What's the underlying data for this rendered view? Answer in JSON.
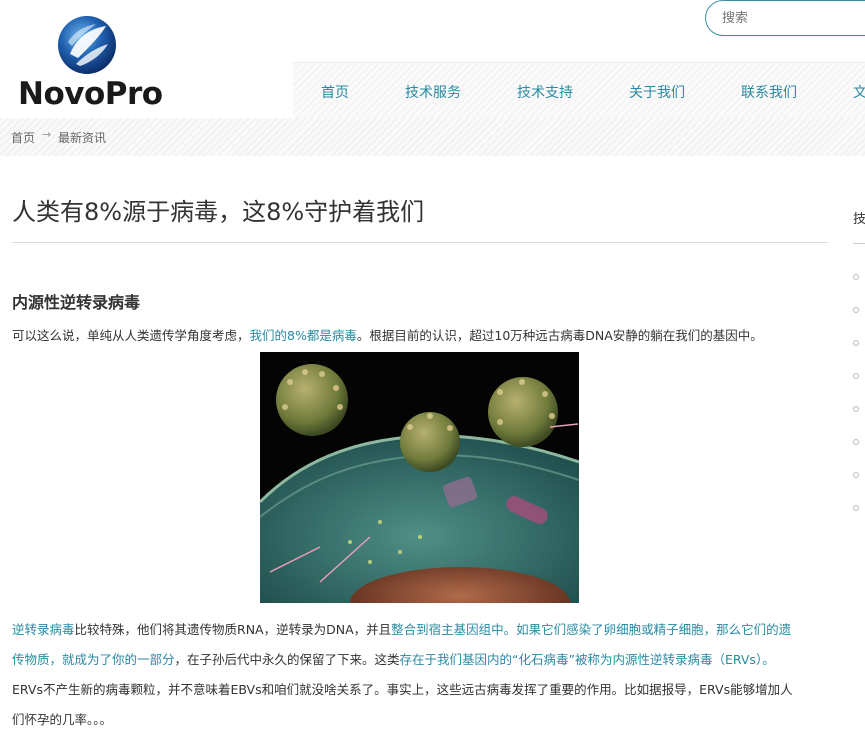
{
  "header": {
    "logo_text": "NovoPro",
    "search_placeholder": "搜索"
  },
  "nav": {
    "items": [
      "首页",
      "技术服务",
      "技术支持",
      "关于我们",
      "联系我们",
      "文"
    ]
  },
  "breadcrumb": {
    "home": "首页",
    "current": "最新资讯"
  },
  "article": {
    "title": "人类有8%源于病毒，这8%守护着我们",
    "section_heading": "内源性逆转录病毒",
    "p1": {
      "a": "可以这么说，单纯从人类遗传学角度考虑，",
      "b": "我们的8%都是病毒",
      "c": "。根据目前的认识，超过10万种远古病毒DNA安静的躺在我们的基因中。"
    },
    "p2": {
      "a": "逆转录病毒",
      "b": "比较特殊，他们将其遗传物质RNA，逆转录为DNA，并且",
      "c": "整合到宿主基因组中。如果它们感染了卵细胞或精子细胞，那么它们的遗",
      "d": "传物质，就成为了你的一部分",
      "e": "，在子孙后代中永久的保留了下来。这类",
      "f": "存在于我们基因内的“化石病毒”被称为内源性逆转录病毒（ERVs）。",
      "g": "ERVs不产生新的病毒颗粒，并不意味着EBVs和咱们就没啥关系了。事实上，这些远古病毒发挥了重要的作用。比如据报导，ERVs能够增加人",
      "h": "们怀孕的几率。。。"
    }
  },
  "sidebar": {
    "title": "技"
  }
}
